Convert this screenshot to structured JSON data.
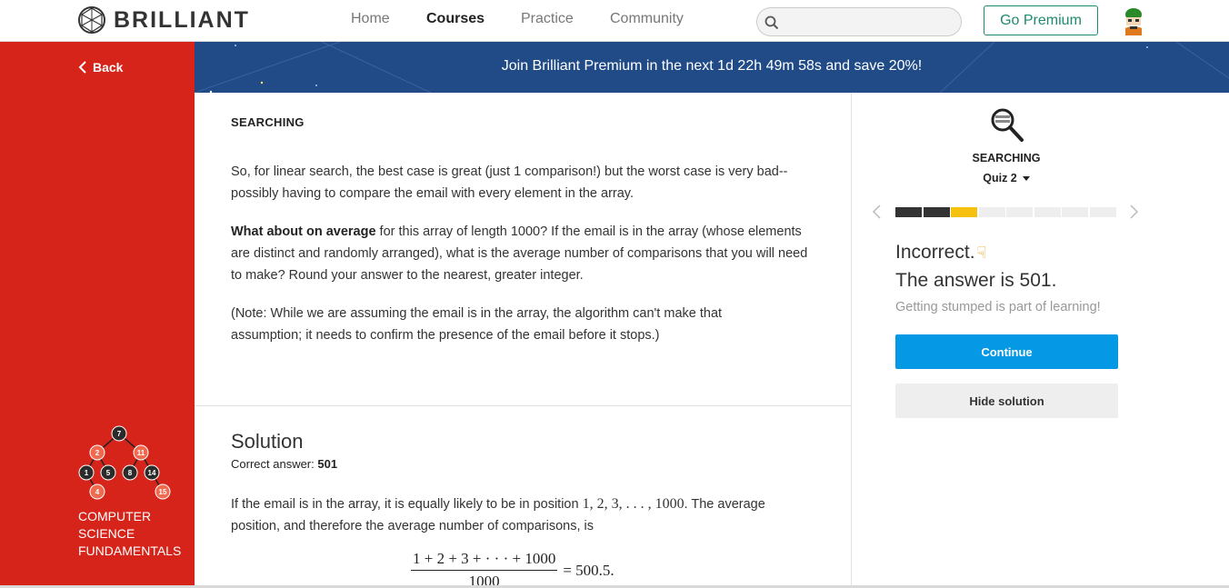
{
  "header": {
    "logo_text": "BRILLIANT",
    "nav": [
      {
        "label": "Home",
        "active": false
      },
      {
        "label": "Courses",
        "active": true
      },
      {
        "label": "Practice",
        "active": false
      },
      {
        "label": "Community",
        "active": false
      }
    ],
    "search": {
      "placeholder": "",
      "value": ""
    },
    "premium_button": "Go Premium"
  },
  "sidebar": {
    "back_label": "Back",
    "course_title": "COMPUTER SCIENCE FUNDAMENTALS",
    "tree_nodes": [
      "7",
      "2",
      "11",
      "1",
      "5",
      "8",
      "14",
      "4",
      "15"
    ]
  },
  "banner": {
    "text": "Join Brilliant Premium in the next 1d 22h 49m 58s and save 20%!"
  },
  "main": {
    "section_label": "SEARCHING",
    "para1": "So, for linear search, the best case is great (just 1 comparison!) but the worst case is very bad-- possibly having to compare the email with every element in the array.",
    "para2_bold": "What about on average",
    "para2_rest": " for this array of length 1000? If the email is in the array (whose elements are distinct and randomly arranged), what is the average number of comparisons that you will need to make? Round your answer to the nearest, greater integer.",
    "para3": "(Note: While we are assuming the email is in the array, the algorithm can't make that assumption; it needs to confirm the presence of the email before it stops.)",
    "solution_title": "Solution",
    "correct_answer_label": "Correct answer: ",
    "correct_answer_value": "501",
    "solution_text_before": "If the email is in the array, it is equally likely to be in position ",
    "solution_math_positions": "1, 2, 3, . . . , 1000",
    "solution_text_after": ". The average position, and therefore the average number of comparisons, is",
    "formula_numerator": "1 + 2 + 3 + · · · + 1000",
    "formula_denominator": "1000",
    "formula_result": "= 500.5."
  },
  "quiz": {
    "section": "SEARCHING",
    "quiz_name": "Quiz 2",
    "progress": {
      "total": 8,
      "completed": 2,
      "current_index": 2
    },
    "status": "Incorrect.",
    "answer_text": "The answer is 501.",
    "encouragement": "Getting stumped is part of learning!",
    "continue_label": "Continue",
    "hide_solution_label": "Hide solution"
  },
  "colors": {
    "sidebar_red": "#d6241b",
    "banner_blue": "#214b87",
    "continue_blue": "#0598e4",
    "premium_green": "#1e8a6f",
    "progress_current": "#f5c10e"
  }
}
